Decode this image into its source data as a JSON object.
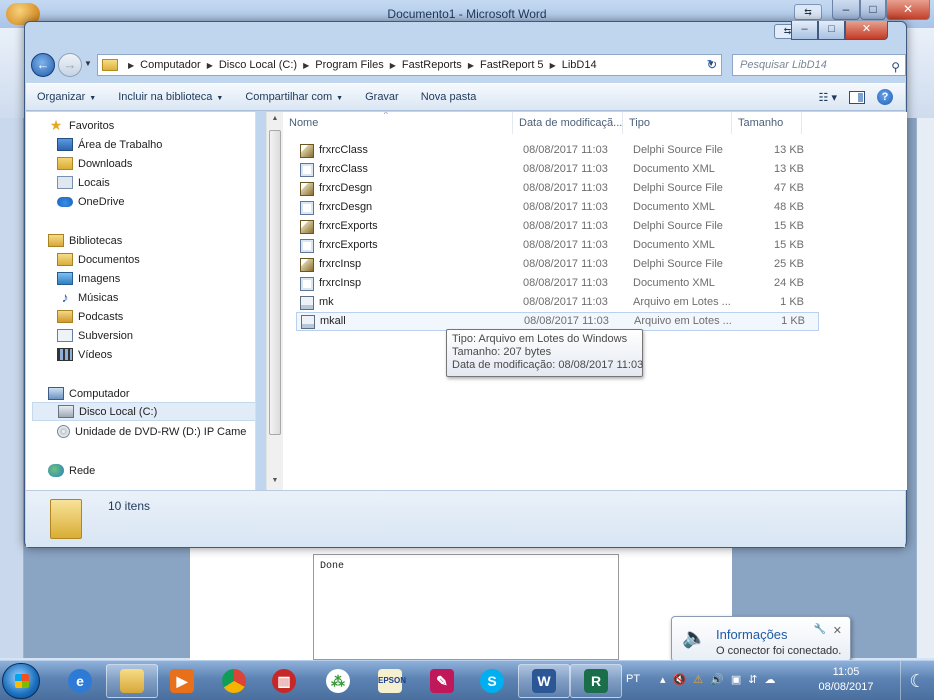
{
  "word": {
    "title": "Documento1 - Microsoft Word",
    "output_text": "Done"
  },
  "explorer": {
    "path": [
      "Computador",
      "Disco Local (C:)",
      "Program Files",
      "FastReports",
      "FastReport 5",
      "LibD14"
    ],
    "search_placeholder": "Pesquisar LibD14",
    "toolbar": {
      "organize": "Organizar",
      "include": "Incluir na biblioteca",
      "share": "Compartilhar com",
      "burn": "Gravar",
      "new_folder": "Nova pasta"
    },
    "nav": {
      "favorites": "Favoritos",
      "desktop": "Área de Trabalho",
      "downloads": "Downloads",
      "places": "Locais",
      "onedrive": "OneDrive",
      "libraries": "Bibliotecas",
      "documents": "Documentos",
      "images": "Imagens",
      "music": "Músicas",
      "podcasts": "Podcasts",
      "subversion": "Subversion",
      "videos": "Vídeos",
      "computer": "Computador",
      "local_disk": "Disco Local (C:)",
      "dvd": "Unidade de DVD-RW (D:) IP Came",
      "network": "Rede"
    },
    "columns": {
      "name": "Nome",
      "date": "Data de modificaçã...",
      "type": "Tipo",
      "size": "Tamanho"
    },
    "files": [
      {
        "name": "frxrcClass",
        "date": "08/08/2017 11:03",
        "type": "Delphi Source File",
        "size": "13 KB",
        "icon": "pas-file-icon"
      },
      {
        "name": "frxrcClass",
        "date": "08/08/2017 11:03",
        "type": "Documento XML",
        "size": "13 KB",
        "icon": "xml-file-icon"
      },
      {
        "name": "frxrcDesgn",
        "date": "08/08/2017 11:03",
        "type": "Delphi Source File",
        "size": "47 KB",
        "icon": "pas-file-icon"
      },
      {
        "name": "frxrcDesgn",
        "date": "08/08/2017 11:03",
        "type": "Documento XML",
        "size": "48 KB",
        "icon": "xml-file-icon"
      },
      {
        "name": "frxrcExports",
        "date": "08/08/2017 11:03",
        "type": "Delphi Source File",
        "size": "15 KB",
        "icon": "pas-file-icon"
      },
      {
        "name": "frxrcExports",
        "date": "08/08/2017 11:03",
        "type": "Documento XML",
        "size": "15 KB",
        "icon": "xml-file-icon"
      },
      {
        "name": "frxrcInsp",
        "date": "08/08/2017 11:03",
        "type": "Delphi Source File",
        "size": "25 KB",
        "icon": "pas-file-icon"
      },
      {
        "name": "frxrcInsp",
        "date": "08/08/2017 11:03",
        "type": "Documento XML",
        "size": "24 KB",
        "icon": "xml-file-icon"
      },
      {
        "name": "mk",
        "date": "08/08/2017 11:03",
        "type": "Arquivo em Lotes ...",
        "size": "1 KB",
        "icon": "batch-file-icon"
      },
      {
        "name": "mkall",
        "date": "08/08/2017 11:03",
        "type": "Arquivo em Lotes ...",
        "size": "1 KB",
        "icon": "batch-file-icon"
      }
    ],
    "tooltip": {
      "line1": "Tipo: Arquivo em Lotes do Windows",
      "line2": "Tamanho: 207 bytes",
      "line3": "Data de modificação: 08/08/2017 11:03"
    },
    "item_count": "10 itens"
  },
  "taskbar": {
    "language": "PT",
    "time": "11:05",
    "date": "08/08/2017",
    "apps": [
      "internet-explorer-icon",
      "windows-explorer-icon",
      "media-player-icon",
      "chrome-icon",
      "archive-icon",
      "network-tool-icon",
      "epson-icon",
      "tool-icon",
      "skype-icon",
      "word-icon",
      "delphi-icon"
    ]
  },
  "balloon": {
    "title": "Informações",
    "text": "O conector foi conectado."
  }
}
